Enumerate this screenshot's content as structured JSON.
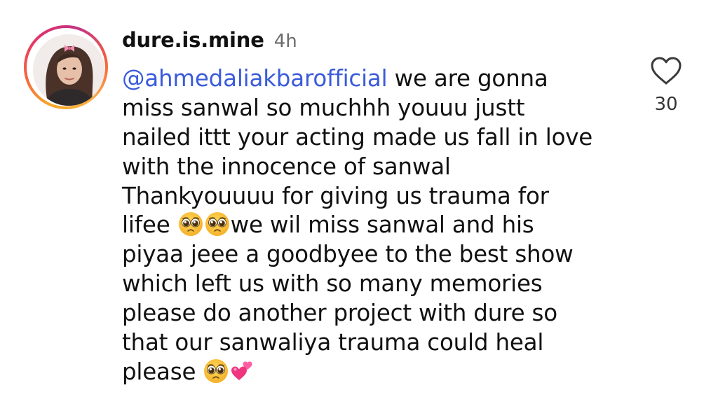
{
  "comment": {
    "username": "dure.is.mine",
    "time": "4h",
    "mention": "@ahmedaliakbarofficial",
    "lines": [
      " we are gonna",
      "miss sanwal so muchhh youuu justt",
      "nailed ittt your acting made us fall in love",
      "with the innocence of sanwal",
      "Thankyouuuu for giving us trauma for",
      "lifee ",
      "we wil miss sanwal and his",
      "piyaa jeee a goodbyee to the best show",
      "which left us with so many memories",
      "please do another project with dure so",
      "that our sanwaliya trauma could heal",
      "please "
    ],
    "emojis": {
      "pleading": "pleading-face-emoji",
      "hearts": "two-hearts-emoji"
    },
    "likes": "30",
    "icons": {
      "like": "heart-outline-icon"
    },
    "colors": {
      "mention": "#3b5bdb",
      "text": "#111111",
      "meta": "#6b6b6b",
      "ring_start": "#f9a826",
      "ring_end": "#c13584"
    }
  }
}
